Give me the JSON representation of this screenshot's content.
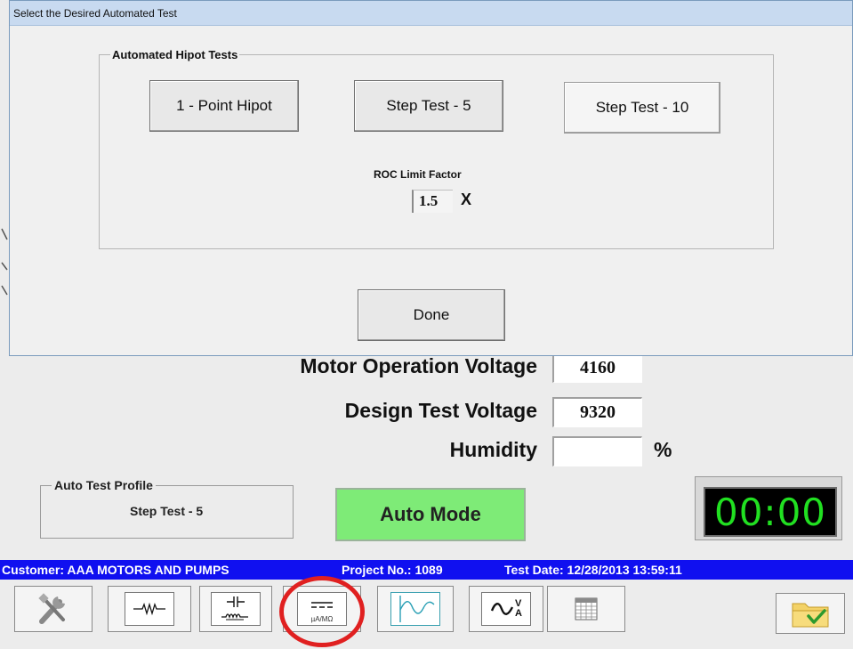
{
  "dialog": {
    "title": "Select the Desired Automated Test",
    "group_label": "Automated Hipot Tests",
    "buttons": {
      "one_point": "1 - Point Hipot",
      "step5": "Step Test - 5",
      "step10": "Step Test - 10"
    },
    "roc_label": "ROC Limit Factor",
    "roc_value": "1.5",
    "roc_unit": "X",
    "done_label": "Done"
  },
  "fields": {
    "motor_voltage_label": "Motor Operation Voltage",
    "motor_voltage_value": "4160",
    "design_voltage_label": "Design Test Voltage",
    "design_voltage_value": "9320",
    "humidity_label": "Humidity",
    "humidity_value": "",
    "humidity_unit": "%"
  },
  "profile": {
    "label": "Auto Test Profile",
    "value": "Step Test - 5"
  },
  "mode": {
    "label": "Auto Mode",
    "color": "#7eeb77"
  },
  "timer": {
    "value": "00:00",
    "color": "#21e021"
  },
  "status_bar": {
    "customer": "Customer: AAA MOTORS AND PUMPS",
    "project": "Project No.: 1089",
    "test_date": "Test Date: 12/28/2013 13:59:11",
    "background": "#1010f0"
  },
  "toolbar": {
    "icons": [
      "tools-icon",
      "resistor-icon",
      "capacitor-inductor-icon",
      "dc-microamp-megaohm-icon",
      "waveform-icon",
      "ac-voltage-amp-icon",
      "table-icon",
      "folder-check-icon"
    ],
    "ua_mohm_caption": "µA/MΩ",
    "volt_sup": "V",
    "amp_sub": "A"
  },
  "annotation": {
    "highlight_color": "#e02020"
  }
}
